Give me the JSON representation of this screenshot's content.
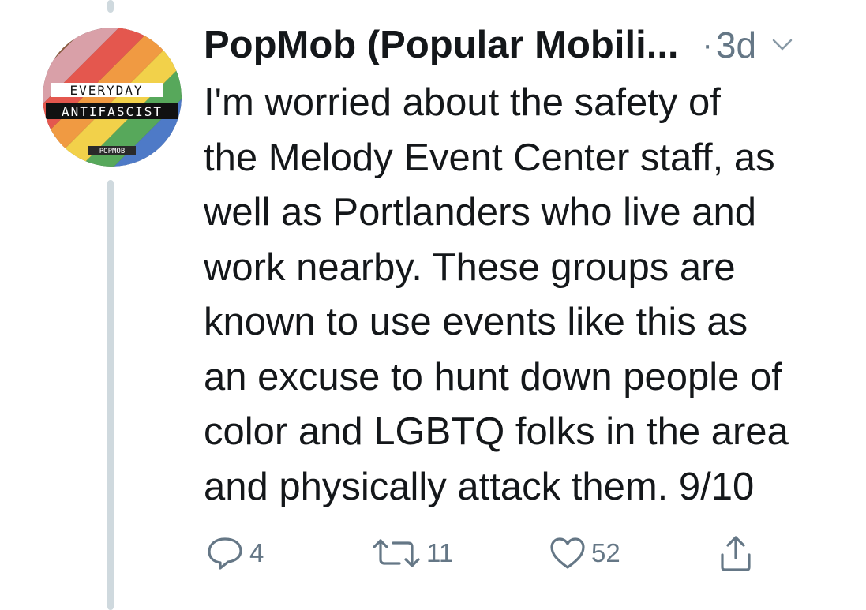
{
  "tweet": {
    "author": "PopMob (Popular Mobili...",
    "separator": "·",
    "time": "3d",
    "text_lines": [
      "I'm worried about the safety of",
      "the Melody Event Center staff, as",
      "well as Portlanders who live and",
      "work nearby. These groups are",
      "known to use events like this as",
      "an excuse to hunt down people of",
      "color and LGBTQ folks in the area",
      "and physically attack them. 9/10"
    ],
    "avatar": {
      "line1": "EVERYDAY",
      "line2": "ANTIFASCIST",
      "badge": "POPMOB"
    }
  },
  "actions": {
    "reply": {
      "icon": "reply-icon",
      "count": "4"
    },
    "retweet": {
      "icon": "retweet-icon",
      "count": "11"
    },
    "like": {
      "icon": "heart-icon",
      "count": "52"
    },
    "share": {
      "icon": "share-icon"
    }
  },
  "colors": {
    "text": "#14171a",
    "muted": "#657786",
    "thread_line": "#cfd9de",
    "stripes": [
      "#9b6fb5",
      "#4e7ac7",
      "#57a85b",
      "#f2d14a",
      "#f09a42",
      "#e4574e",
      "#d9a0a8",
      "#8b5a3c",
      "#3a3a3a"
    ]
  }
}
